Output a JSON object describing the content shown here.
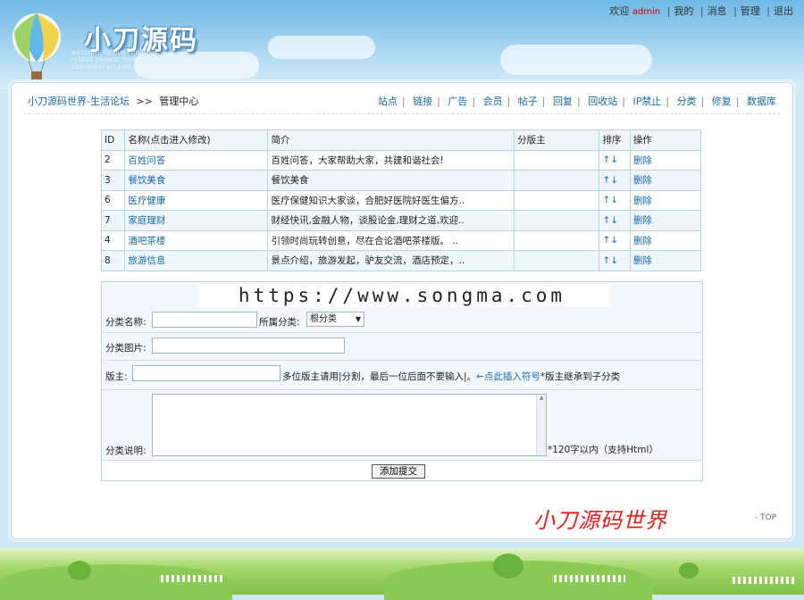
{
  "header": {
    "logo_title": "小刀源码",
    "logo_sub_lines": [
      "WELCOME TO OUR FORUMS",
      "PLEASE CHANGE YOUR SCREEN RESOLUTION TO 1024X768",
      "COPYRIGHT (C) 2005-2006 WE FORUM ALL RIGHTS RESERVED"
    ],
    "welcome": "欢迎",
    "user": "admin",
    "links": [
      "我的",
      "消息",
      "管理",
      "退出"
    ]
  },
  "breadcrumb": {
    "home": "小刀源码世界-生活论坛",
    "arrow": ">>",
    "current": "管理中心"
  },
  "nav": [
    "站点",
    "链接",
    "广告",
    "会员",
    "帖子",
    "回复",
    "回收站",
    "IP禁止",
    "分类",
    "修复",
    "数据库"
  ],
  "table": {
    "headers": [
      "ID",
      "名称(点击进入修改)",
      "简介",
      "分版主",
      "排序",
      "操作"
    ],
    "rows": [
      {
        "id": "2",
        "name": "百姓问答",
        "intro": "百姓问答，大家帮助大家，共建和谐社会!",
        "mod": "",
        "sort": "↑↓",
        "op": "删除"
      },
      {
        "id": "3",
        "name": "餐饮美食",
        "intro": "餐饮美食",
        "mod": "",
        "sort": "↑↓",
        "op": "删除"
      },
      {
        "id": "6",
        "name": "医疗健康",
        "intro": "医疗保健知识大家谈，合肥好医院好医生偏方..",
        "mod": "",
        "sort": "↑↓",
        "op": "删除"
      },
      {
        "id": "7",
        "name": "家庭理财",
        "intro": "财经快讯,金融人物，谈股论金,理财之道,欢迎..",
        "mod": "",
        "sort": "↑↓",
        "op": "删除"
      },
      {
        "id": "4",
        "name": "酒吧茶楼",
        "intro": "引领时尚玩转创意，尽在合论酒吧茶楼版。 ..",
        "mod": "",
        "sort": "↑↓",
        "op": "删除"
      },
      {
        "id": "8",
        "name": "旅游信息",
        "intro": "景点介绍，旅游发起，驴友交流，酒店预定，..",
        "mod": "",
        "sort": "↑↓",
        "op": "删除"
      }
    ]
  },
  "form": {
    "watermark": "https://www.songma.com",
    "cat_name_label": "分类名称:",
    "cat_name_value": "",
    "parent_label": "所属分类:",
    "parent_value": "根分类",
    "image_label": "分类图片:",
    "image_value": "",
    "mod_label": "版主:",
    "mod_value": "",
    "mod_hint": "多位版主请用|分割，最后一位后面不要输入|。",
    "mod_link": "←点此插入符号",
    "mod_hint2": "*版主继承到子分类",
    "desc_label": "分类说明:",
    "desc_value": "",
    "desc_hint": "*120字以内（支持Html）",
    "submit": "添加提交"
  },
  "footer": {
    "brand": "小刀源码世界",
    "top": "- TOP"
  },
  "colors": {
    "link": "#1a6aa7",
    "brand_red": "#e0201c",
    "border": "#b9d4e6",
    "row_alt": "#f0f7fc"
  }
}
